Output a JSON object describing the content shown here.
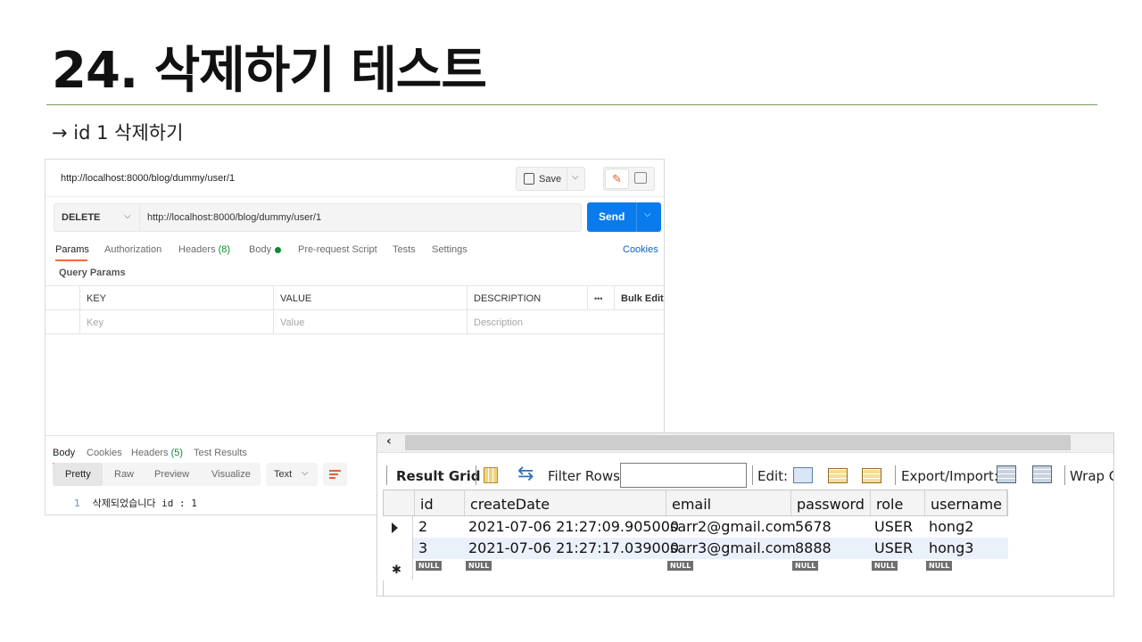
{
  "slide": {
    "title": "24. 삭제하기 테스트",
    "subtitle": "→ id 1 삭제하기"
  },
  "postman": {
    "tab_url": "http://localhost:8000/blog/dummy/user/1",
    "save_label": "Save",
    "method": "DELETE",
    "url": "http://localhost:8000/blog/dummy/user/1",
    "send_label": "Send",
    "request_tabs": {
      "params": "Params",
      "authorization": "Authorization",
      "headers": "Headers",
      "headers_count": "(8)",
      "body": "Body",
      "pre_request": "Pre-request Script",
      "tests": "Tests",
      "settings": "Settings",
      "cookies": "Cookies"
    },
    "query_params_label": "Query Params",
    "table": {
      "headers": [
        "KEY",
        "VALUE",
        "DESCRIPTION"
      ],
      "more_icon": "•••",
      "bulk_edit": "Bulk Edit",
      "placeholders": [
        "Key",
        "Value",
        "Description"
      ]
    },
    "response_tabs": {
      "body": "Body",
      "cookies": "Cookies",
      "headers": "Headers",
      "headers_count": "(5)",
      "test_results": "Test Results"
    },
    "format_tabs": [
      "Pretty",
      "Raw",
      "Preview",
      "Visualize"
    ],
    "content_type": "Text",
    "response": {
      "line_number": "1",
      "text": "삭제되었습니다 id : 1"
    }
  },
  "workbench": {
    "toolbar": {
      "result_grid": "Result Grid",
      "filter_rows": "Filter Rows:",
      "filter_value": "",
      "edit": "Edit:",
      "export_import": "Export/Import:",
      "wrap": "Wrap C"
    },
    "columns": [
      "id",
      "createDate",
      "email",
      "password",
      "role",
      "username"
    ],
    "rows": [
      {
        "id": "2",
        "createDate": "2021-07-06 21:27:09.905000",
        "email": "sarr2@gmail.com",
        "password": "5678",
        "role": "USER",
        "username": "hong2"
      },
      {
        "id": "3",
        "createDate": "2021-07-06 21:27:17.039000",
        "email": "sarr3@gmail.com",
        "password": "8888",
        "role": "USER",
        "username": "hong3"
      }
    ],
    "null_label": "NULL"
  }
}
